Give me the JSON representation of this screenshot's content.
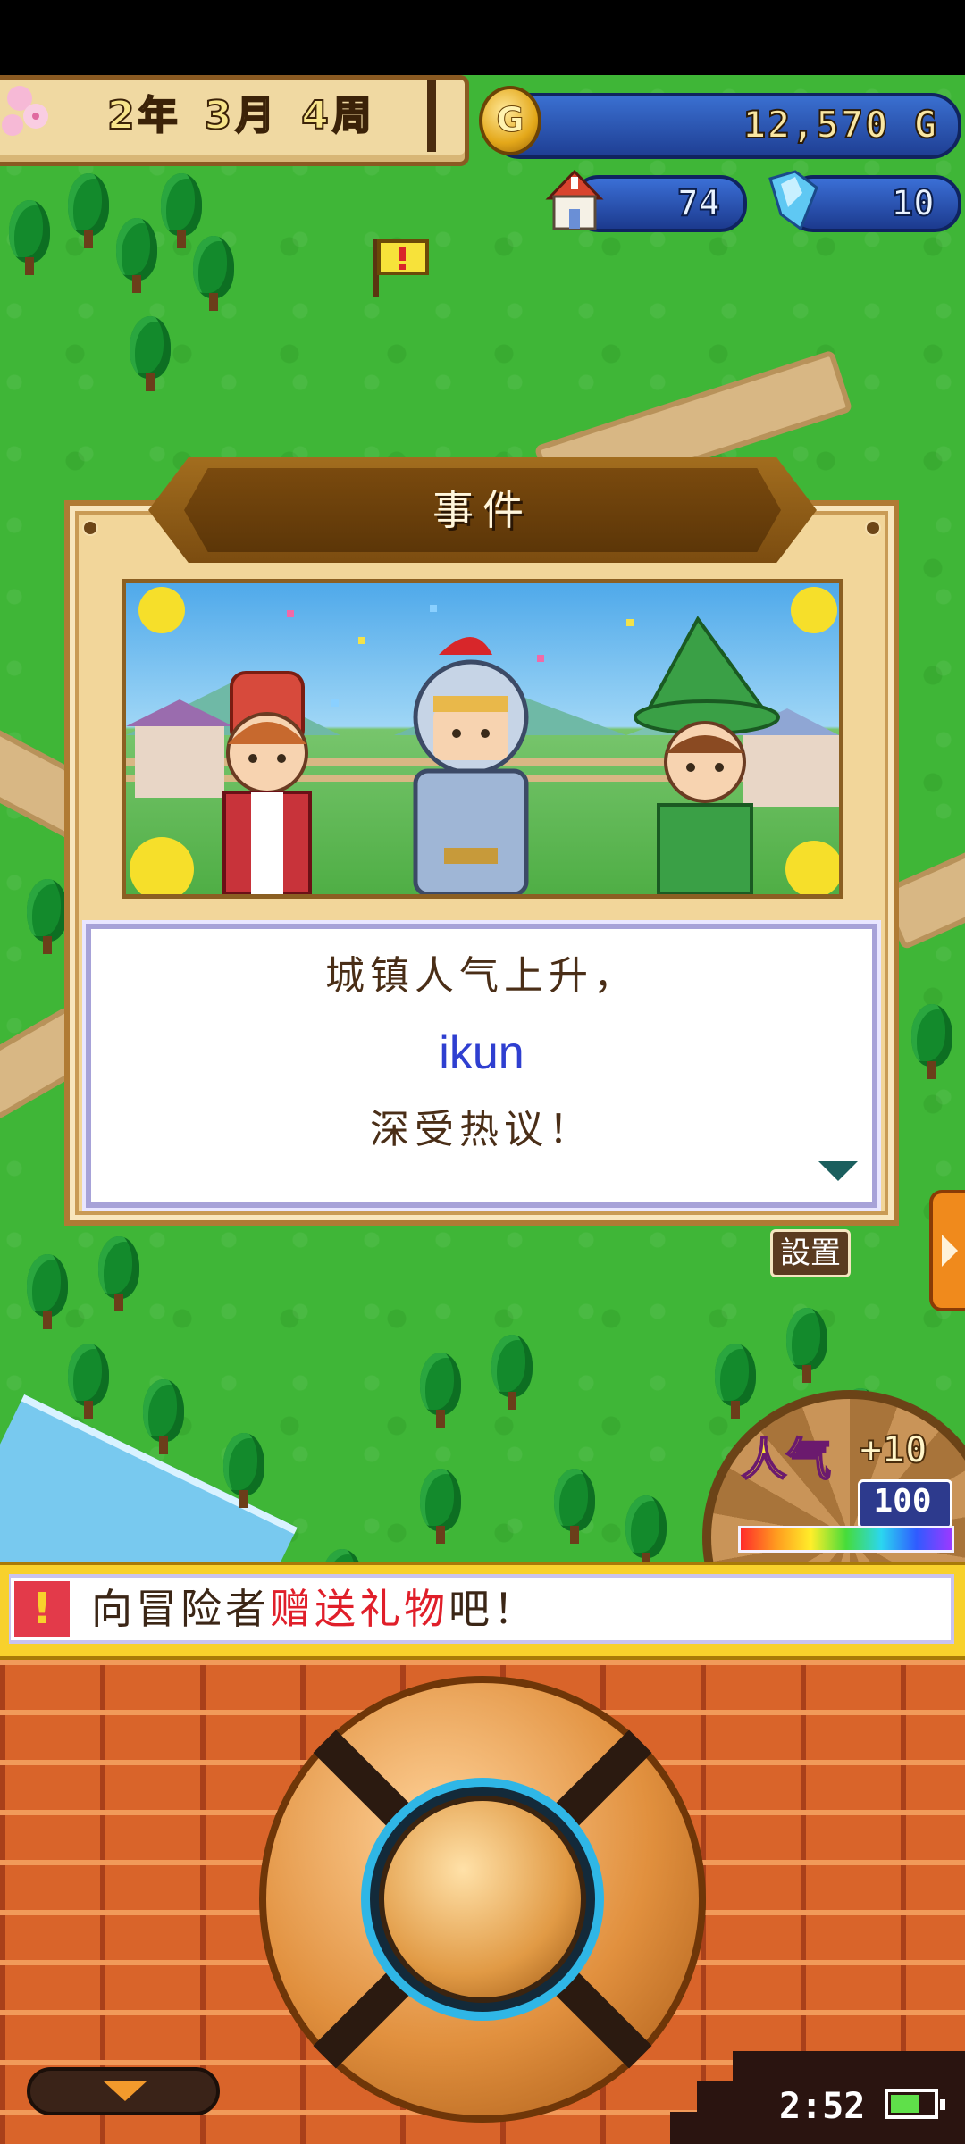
{
  "hud": {
    "date": {
      "year": "2年",
      "month": "3月",
      "week": "4周"
    },
    "gold": {
      "icon": "gold-coin-icon",
      "coin_letter": "G",
      "value": "12,570 G"
    },
    "houses": {
      "icon": "house-icon",
      "value": "74"
    },
    "crystals": {
      "icon": "crystal-icon",
      "value": "10"
    }
  },
  "map": {
    "event_marker_icon": "exclamation-flag-icon"
  },
  "event_dialog": {
    "title": "事件",
    "illustration": "townsfolk-celebration-illustration",
    "message": {
      "line1": "城镇人气上升，",
      "name": "ikun",
      "line3": "深受热议！"
    },
    "next_icon": "next-page-triangle-icon"
  },
  "side": {
    "settings_label": "設置",
    "expand_icon": "side-expand-arrow-icon"
  },
  "popularity": {
    "label": "人气",
    "bonus": "+10",
    "value": "100",
    "level_fraction": 1.0
  },
  "hint": {
    "icon": "exclamation-icon",
    "icon_glyph": "!",
    "text_before": "向冒险者",
    "text_highlight": "赠送礼物",
    "text_after": "吧！"
  },
  "controls": {
    "dpad": "directional-pad",
    "menu_toggle_icon": "chevron-down-icon"
  },
  "status": {
    "time": "2:52",
    "battery_icon": "battery-icon",
    "battery_level": 0.7
  },
  "colors": {
    "grass": "#3fb637",
    "gold_text": "#f9e7a3",
    "hint_highlight": "#e01f2a",
    "name_blue": "#2f3fd0",
    "brick": "#d9642a"
  }
}
